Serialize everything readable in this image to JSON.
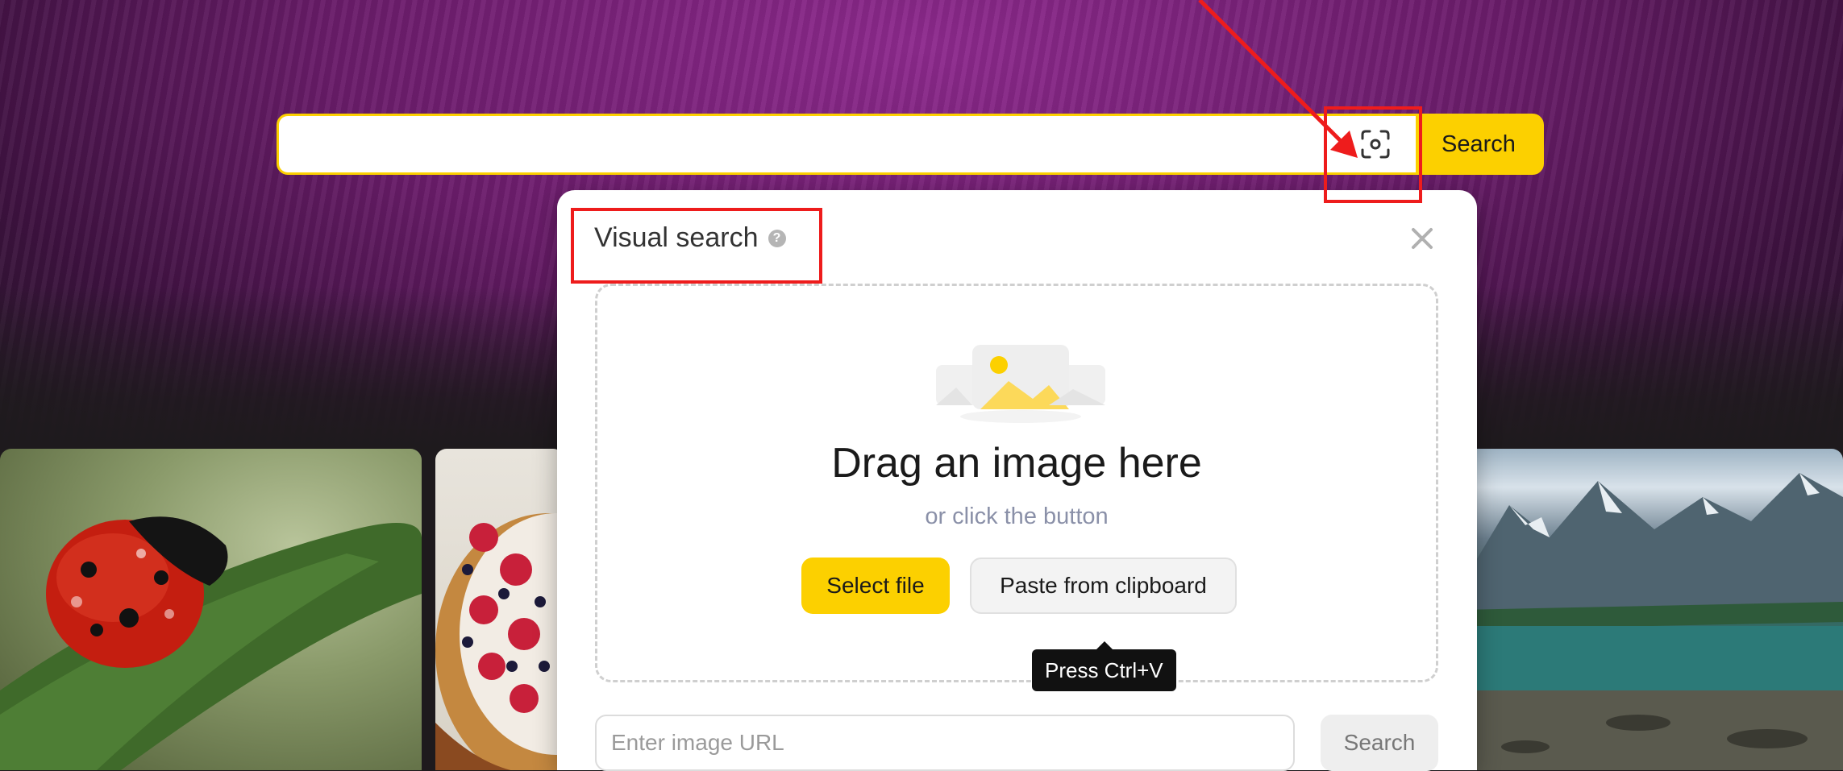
{
  "search": {
    "value": "",
    "button_label": "Search",
    "camera_icon": "camera-lens-icon"
  },
  "visual_search_panel": {
    "title": "Visual search",
    "help_icon_glyph": "?",
    "close_icon": "close-icon",
    "dropzone": {
      "title": "Drag an image here",
      "subtitle": "or click the button",
      "illustration_icon": "image-placeholder-icon"
    },
    "select_file_label": "Select file",
    "paste_label": "Paste from clipboard",
    "paste_tooltip": "Press Ctrl+V",
    "url_placeholder": "Enter image URL",
    "url_search_label": "Search"
  },
  "gallery": {
    "tiles": [
      "ladybug",
      "berry-tart",
      "mountain-lake"
    ]
  },
  "colors": {
    "accent": "#fcd000",
    "annotation": "#ee1c1c"
  }
}
